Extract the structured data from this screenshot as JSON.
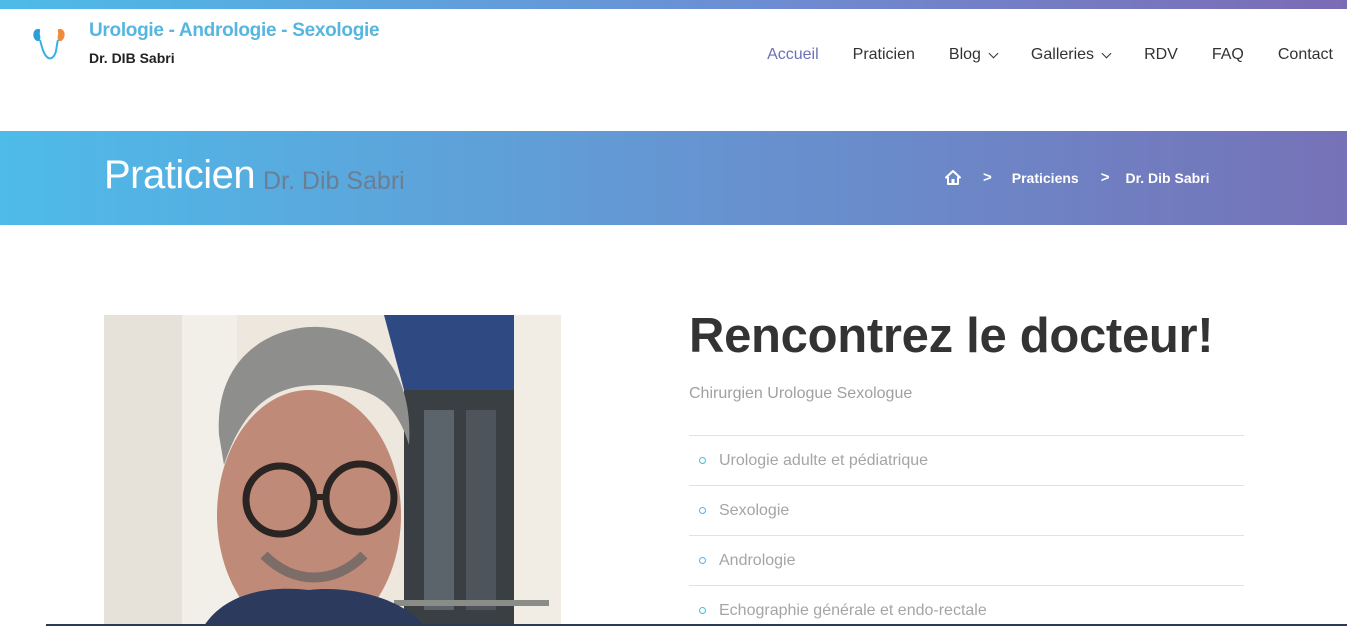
{
  "header": {
    "title": "Urologie - Andrologie - Sexologie",
    "subtitle": "Dr. DIB Sabri",
    "logo_icon": "kidney-logo-icon"
  },
  "nav": {
    "items": [
      {
        "label": "Accueil",
        "active": true
      },
      {
        "label": "Praticien"
      },
      {
        "label": "Blog"
      },
      {
        "label": "Galleries"
      },
      {
        "label": "RDV"
      },
      {
        "label": "FAQ"
      },
      {
        "label": "Contact"
      }
    ]
  },
  "hero": {
    "title": "Praticien",
    "subtitle": "Dr. Dib Sabri",
    "breadcrumb": {
      "home_icon": "home-icon",
      "sep": ">",
      "item1": "Praticiens",
      "item2": "Dr. Dib Sabri"
    }
  },
  "main": {
    "heading": "Rencontrez le docteur!",
    "subheading": "Chirurgien Urologue Sexologue",
    "specialties": [
      "Urologie adulte et pédiatrique",
      "Sexologie",
      "Andrologie",
      "Echographie générale et endo-rectale"
    ]
  },
  "colors": {
    "accent": "#55b6e0",
    "nav_active": "#6b72b6",
    "gradient_start": "#4ebbe9",
    "gradient_end": "#7672b8"
  }
}
